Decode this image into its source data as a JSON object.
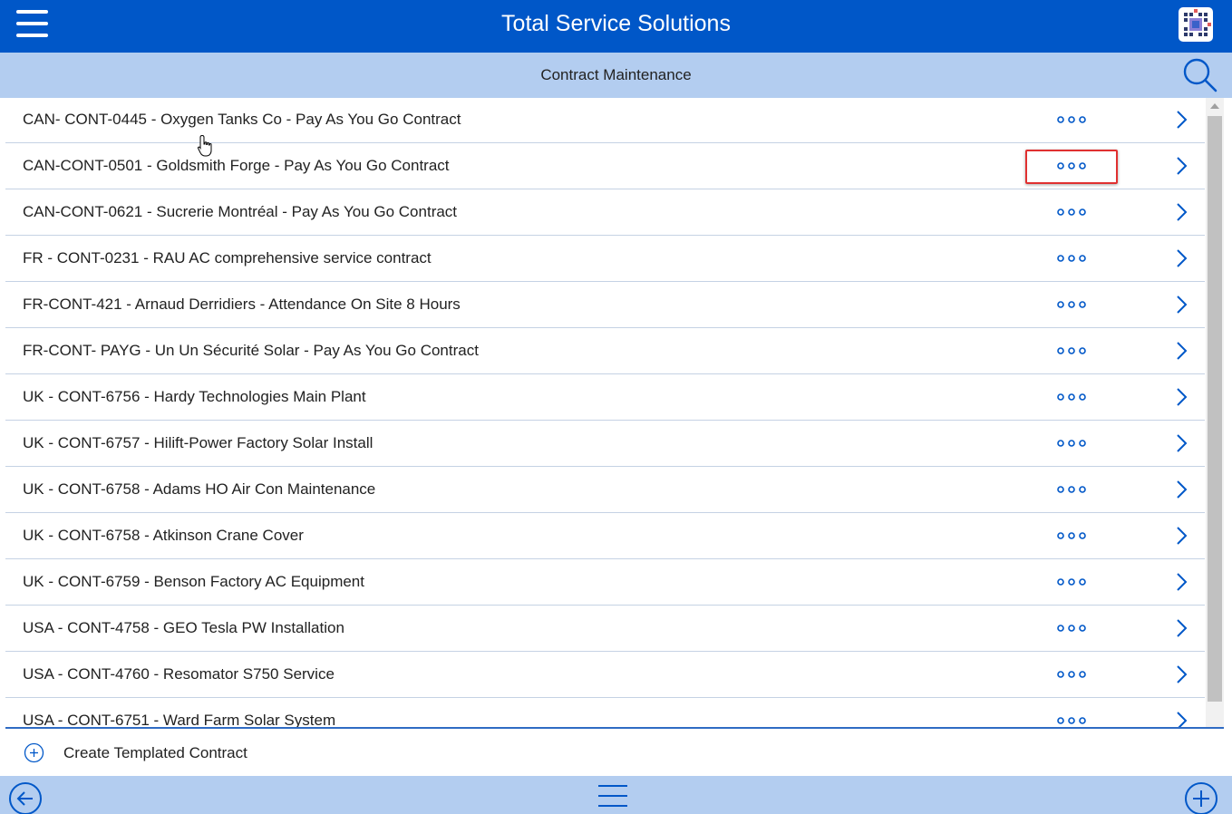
{
  "app": {
    "title": "Total Service Solutions",
    "accent_color": "#0057c8",
    "subheader_color": "#b3cdf0"
  },
  "header": {
    "menu_icon": "hamburger-icon",
    "logo_icon": "app-logo-icon"
  },
  "subheader": {
    "title": "Contract Maintenance",
    "search_icon": "search-icon"
  },
  "contracts": [
    {
      "label": "CAN- CONT-0445 - Oxygen Tanks Co - Pay As You Go Contract"
    },
    {
      "label": "CAN-CONT-0501 - Goldsmith Forge - Pay As You Go Contract",
      "highlighted": true
    },
    {
      "label": "CAN-CONT-0621 - Sucrerie Montréal - Pay As You Go Contract"
    },
    {
      "label": "FR - CONT-0231 - RAU AC comprehensive service contract"
    },
    {
      "label": "FR-CONT-421 - Arnaud Derridiers - Attendance On Site 8 Hours"
    },
    {
      "label": "FR-CONT- PAYG - Un Un Sécurité Solar - Pay As You Go Contract"
    },
    {
      "label": "UK - CONT-6756 - Hardy Technologies Main Plant"
    },
    {
      "label": "UK - CONT-6757 - Hilift-Power Factory Solar Install"
    },
    {
      "label": "UK - CONT-6758 - Adams HO Air Con Maintenance"
    },
    {
      "label": "UK - CONT-6758 - Atkinson Crane Cover"
    },
    {
      "label": "UK - CONT-6759 - Benson Factory AC Equipment"
    },
    {
      "label": "USA - CONT-4758 - GEO Tesla PW Installation"
    },
    {
      "label": "USA - CONT-4760 - Resomator S750 Service"
    },
    {
      "label": "USA - CONT-6751 - Ward Farm Solar System"
    }
  ],
  "create": {
    "label": "Create Templated Contract",
    "icon": "plus-circle-icon"
  },
  "footer": {
    "back_icon": "back-arrow-icon",
    "menu_icon": "list-menu-icon",
    "add_icon": "add-circle-icon"
  }
}
